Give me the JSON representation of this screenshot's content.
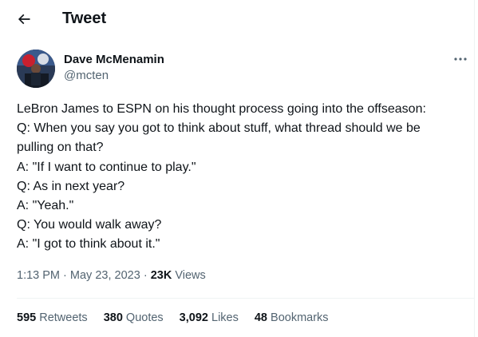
{
  "header": {
    "title": "Tweet"
  },
  "author": {
    "name": "Dave McMenamin",
    "handle": "@mcten"
  },
  "tweet": {
    "lines": [
      "LeBron James to ESPN on his thought process going into the offseason:",
      "Q: When you say you got to think about stuff, what thread should we be",
      "pulling on that?",
      "A: \"If I want to continue to play.\"",
      "Q: As in next year?",
      "A: \"Yeah.\"",
      "Q: You would walk away?",
      "A: \"I got to think about it.\""
    ]
  },
  "meta": {
    "time": "1:13 PM",
    "separator": "·",
    "date": "May 23, 2023",
    "views_count": "23K",
    "views_label": "Views"
  },
  "stats": {
    "retweets": {
      "count": "595",
      "label": "Retweets"
    },
    "quotes": {
      "count": "380",
      "label": "Quotes"
    },
    "likes": {
      "count": "3,092",
      "label": "Likes"
    },
    "bookmarks": {
      "count": "48",
      "label": "Bookmarks"
    }
  },
  "icons": {
    "back": "back-arrow-icon",
    "more": "more-dots-icon"
  }
}
